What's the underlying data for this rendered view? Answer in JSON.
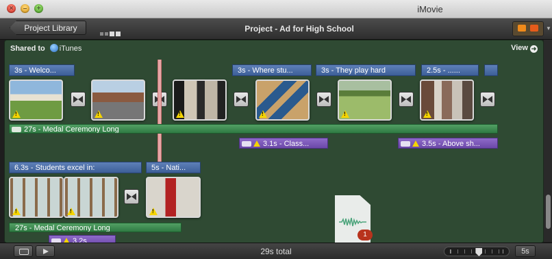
{
  "window": {
    "app_title": "iMovie"
  },
  "toolbar": {
    "back_label": "Project Library",
    "project_title": "Project - Ad for High School"
  },
  "pane": {
    "shared_label": "Shared to",
    "shared_service": "iTunes",
    "view_label": "View"
  },
  "row1": {
    "titles": [
      "3s - Welco...",
      "3s - Where stu...",
      "3s - They play hard",
      "2.5s - ......"
    ],
    "music": "27s - Medal Ceremony Long",
    "sfx": [
      "3.1s - Class...",
      "3.5s - Above sh..."
    ]
  },
  "row2": {
    "titles": [
      "6.3s - Students excel in:",
      "5s - Nati..."
    ],
    "music": "27s - Medal Ceremony Long",
    "sfx": [
      "3.2s"
    ]
  },
  "status": {
    "total": "29s total",
    "zoom_label": "5s",
    "zoom_level": 0.55
  },
  "unused_badge": "1"
}
